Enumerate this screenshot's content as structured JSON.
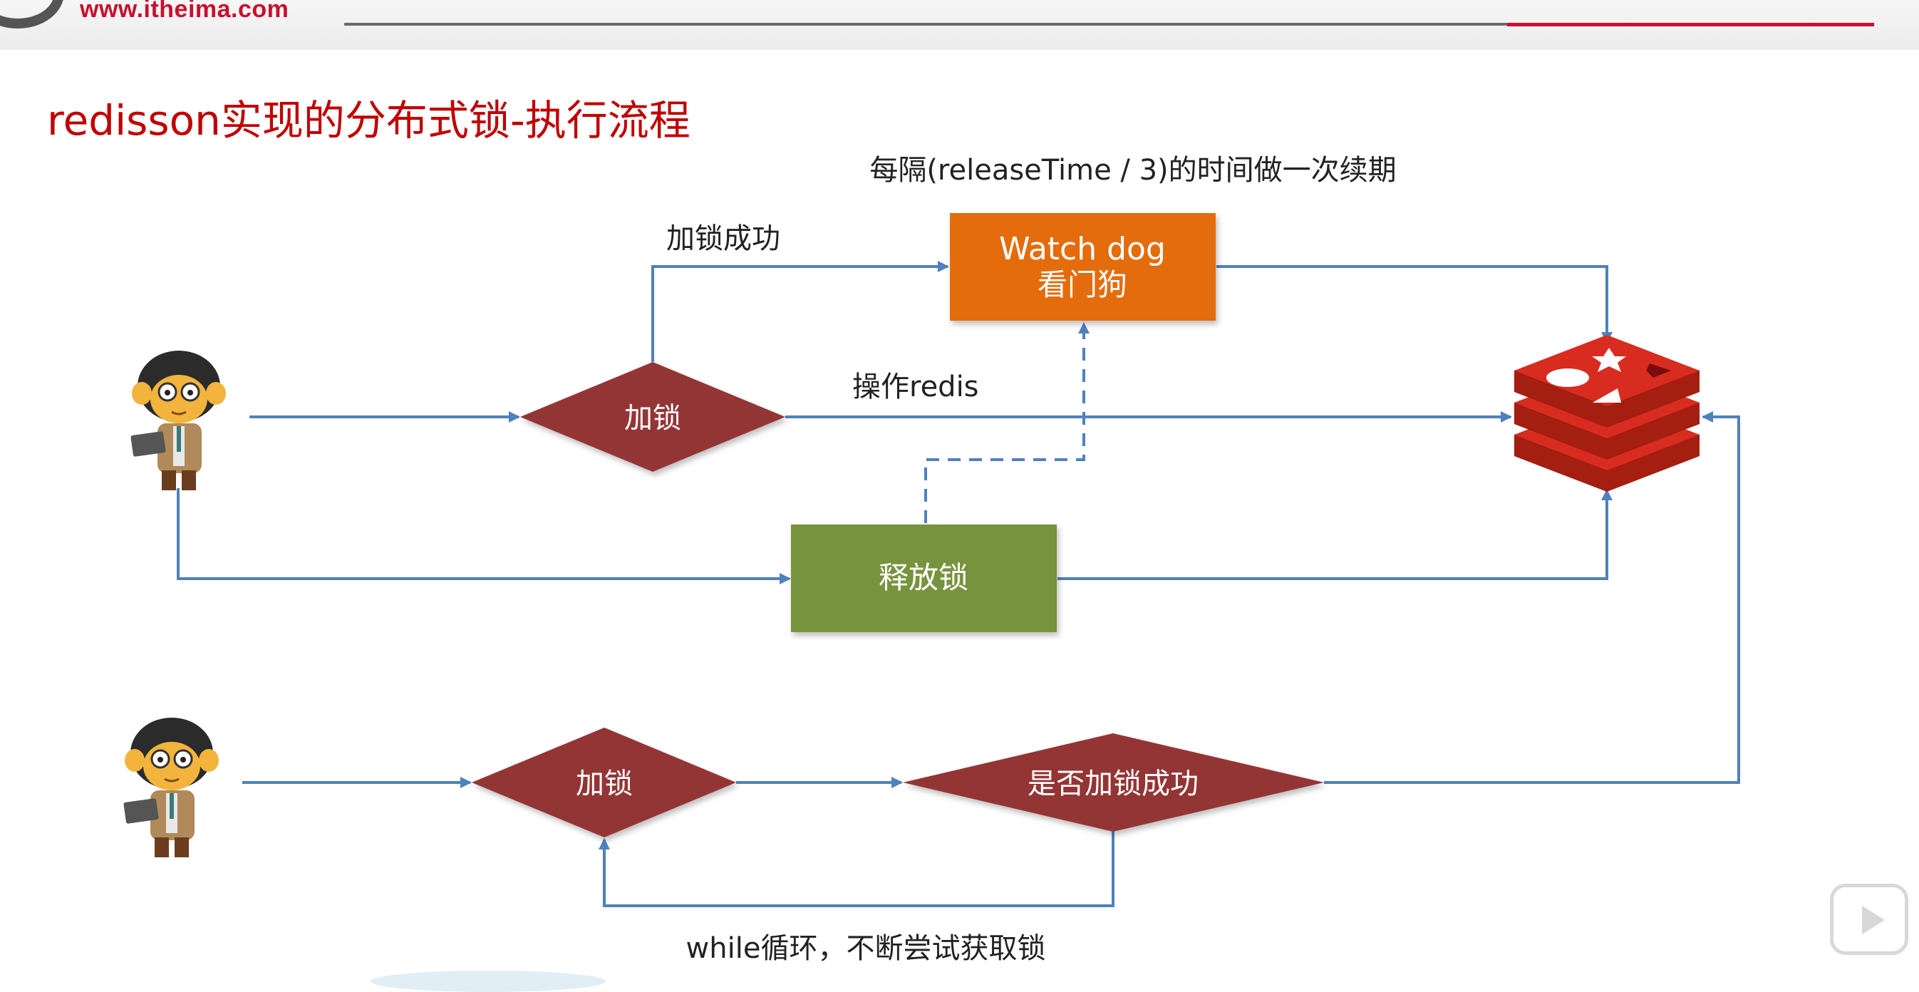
{
  "header": {
    "url": "www.itheima.com"
  },
  "title": "redisson实现的分布式锁-执行流程",
  "labels": {
    "renew_note": "每隔(releaseTime / 3)的时间做一次续期",
    "lock_success": "加锁成功",
    "operate_redis": "操作redis",
    "while_loop": "while循环，不断尝试获取锁"
  },
  "nodes": {
    "watchdog_line1": "Watch dog",
    "watchdog_line2": "看门狗",
    "lock_top": "加锁",
    "release": "释放锁",
    "lock_bottom": "加锁",
    "lock_check": "是否加锁成功"
  },
  "icons": {
    "avatar": "programmer-monkey-avatar",
    "redis": "redis-logo-icon",
    "player": "video-play-icon"
  },
  "colors": {
    "title": "#c00000",
    "diamond": "#943634",
    "watchdog": "#e46c0a",
    "release": "#77933c",
    "arrow": "#4f81bd",
    "redis": "#d82c20"
  }
}
